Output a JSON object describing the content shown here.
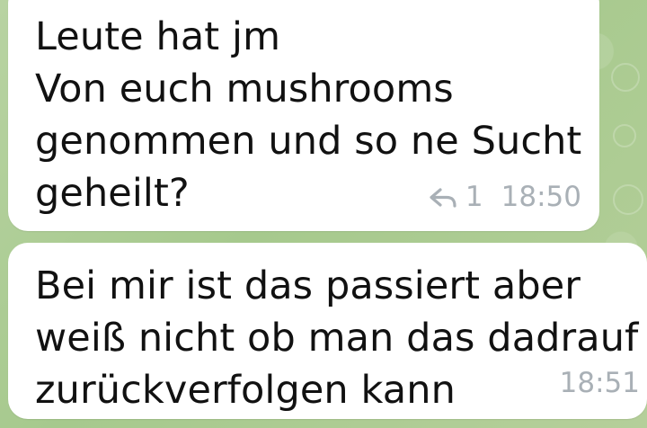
{
  "messages": [
    {
      "lines": [
        "Leute hat jm",
        "Von euch mushrooms",
        "genommen und so ne Sucht",
        "geheilt?"
      ],
      "reply_count": "1",
      "time": "18:50"
    },
    {
      "lines": [
        "Bei mir ist das passiert aber",
        "weiß nicht ob man das dadrauf",
        "zurückverfolgen kann"
      ],
      "time": "18:51"
    }
  ],
  "icons": {
    "reply": "reply-icon"
  }
}
